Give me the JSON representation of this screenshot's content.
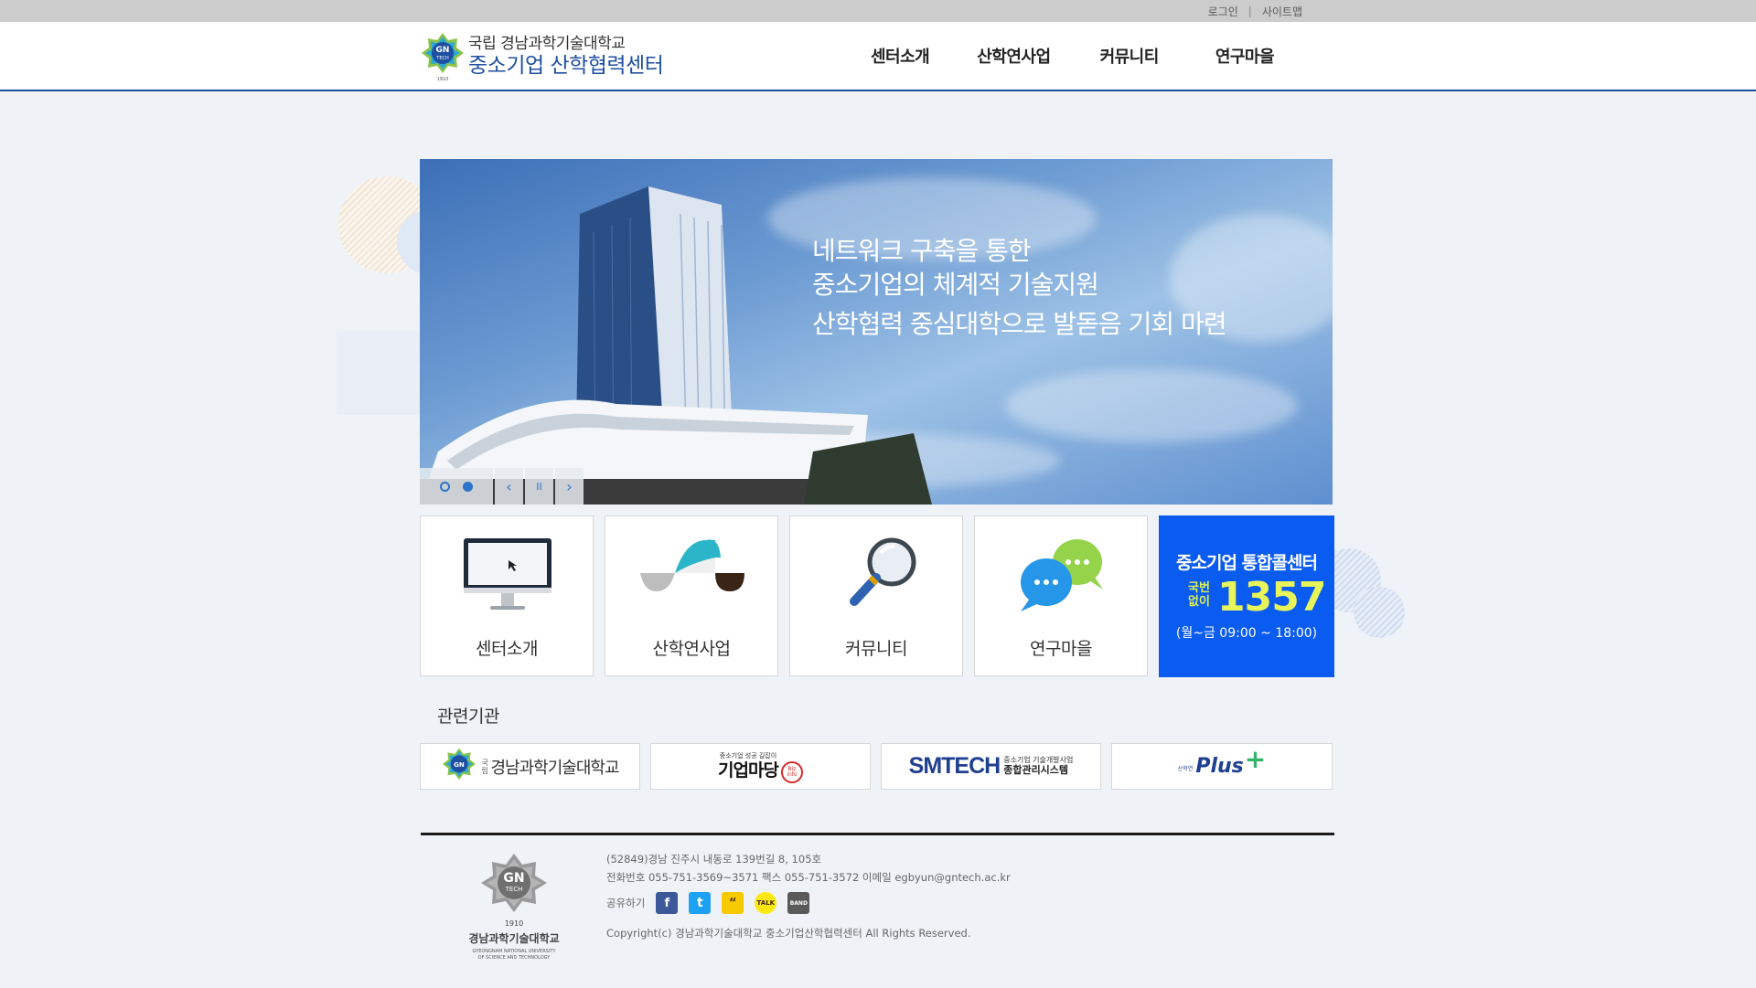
{
  "topbar": {
    "login": "로그인",
    "separator": "|",
    "sitemap": "사이트맵"
  },
  "header": {
    "logo_sub": "국립 경남과학기술대학교",
    "logo_main": "중소기업 산학협력센터",
    "logo_badge": "GN TECH",
    "logo_year": "1910",
    "nav": [
      "센터소개",
      "산학연사업",
      "커뮤니티",
      "연구마을"
    ]
  },
  "banner": {
    "line1": "네트워크 구축을 통한",
    "line2": "중소기업의 체계적 기술지원",
    "line3": "산학협력 중심대학으로 발돋음 기회 마련",
    "prev_icon": "‹",
    "pause_icon": "II",
    "next_icon": "›"
  },
  "quick": [
    {
      "label": "센터소개",
      "icon": "monitor-icon"
    },
    {
      "label": "산학연사업",
      "icon": "wave-icon"
    },
    {
      "label": "커뮤니티",
      "icon": "magnifier-icon"
    },
    {
      "label": "연구마을",
      "icon": "chat-bubble-icon"
    }
  ],
  "callcenter": {
    "title": "중소기업 통합콜센터",
    "prefix_line1": "국번",
    "prefix_line2": "없이",
    "number": "1357",
    "hours": "(월~금 09:00 ~ 18:00)"
  },
  "related": {
    "title": "관련기관",
    "partners": [
      {
        "name": "경남과학기술대학교",
        "prefix": "국립"
      },
      {
        "name": "기업마당",
        "sub": "중소기업 성공 길잡이",
        "badge": "Biz info"
      },
      {
        "name": "SMTECH",
        "sub1": "중소기업 기술개발사업",
        "sub2": "종합관리시스템"
      },
      {
        "name": "Plus",
        "sub": "산학연"
      }
    ]
  },
  "footer": {
    "address": "(52849)경남 진주시 내동로 139번길 8, 105호",
    "contact": "전화번호 055-751-3569~3571 팩스 055-751-3572 이메일 egbyun@gntech.ac.kr",
    "share_label": "공유하기",
    "share_icons": [
      "facebook-icon",
      "twitter-icon",
      "kakaostory-icon",
      "kakaotalk-icon",
      "band-icon"
    ],
    "copyright": "Copyright(c) 경남과학기술대학교 중소기업산학협력센터 All Rights Reserved.",
    "logo_badge": "GN TECH",
    "logo_year": "1910",
    "logo_name": "경남과학기술대학교",
    "logo_en1": "GYEONGNAM NATIONAL UNIVERSITY",
    "logo_en2": "OF SCIENCE AND TECHNOLOGY"
  },
  "colors": {
    "accent": "#1f4fa0",
    "callcenter_bg": "#0a5bf0",
    "callcenter_number": "#e8f55a",
    "page_bg": "#eff3f7"
  }
}
